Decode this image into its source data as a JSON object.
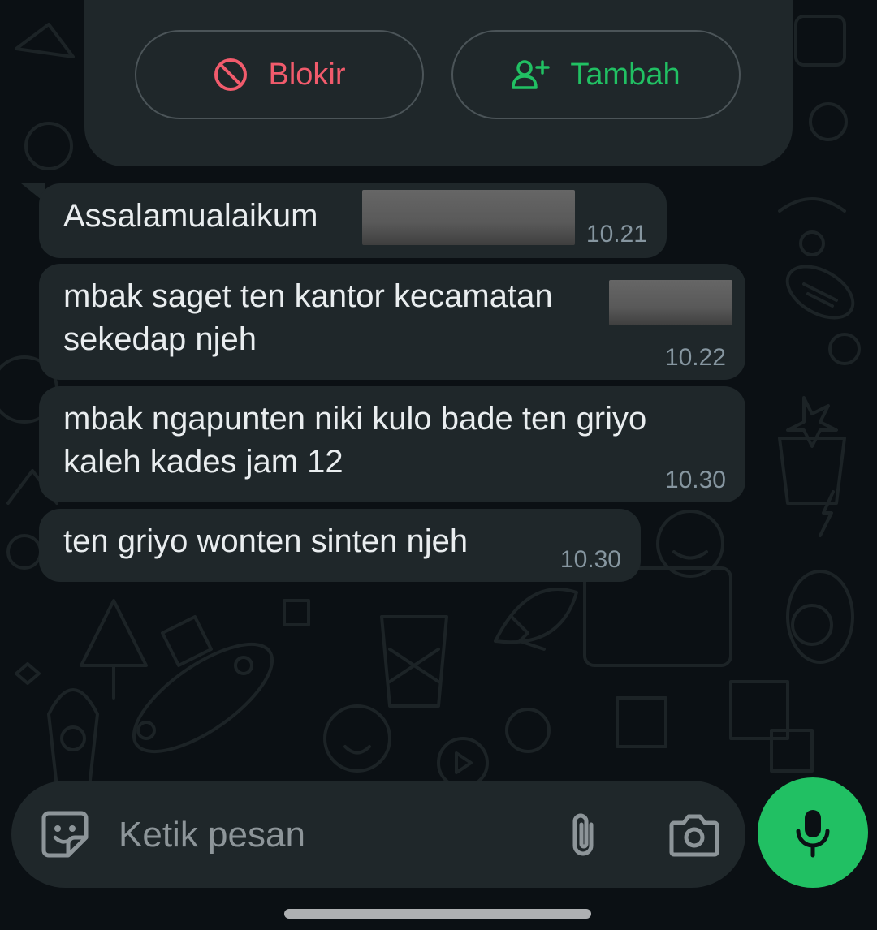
{
  "contact_actions": {
    "block_label": "Blokir",
    "add_label": "Tambah",
    "block_color": "#f15b6c",
    "add_color": "#21c063"
  },
  "messages": [
    {
      "text": "Assalamualaikum",
      "time": "10.21"
    },
    {
      "text": "mbak saget ten kantor kecamatan",
      "text_line2": "sekedap njeh",
      "time": "10.22"
    },
    {
      "text": "mbak ngapunten niki kulo bade ten griyo",
      "text_line2": "kaleh kades jam 12",
      "time": "10.30"
    },
    {
      "text": "ten griyo wonten sinten njeh",
      "time": "10.30"
    }
  ],
  "composer": {
    "placeholder": "Ketik pesan",
    "icons": [
      "sticker-icon",
      "attach-icon",
      "camera-icon",
      "mic-icon"
    ],
    "accent": "#21c063"
  },
  "theme": {
    "background": "#0b1014",
    "bubble": "#1f272a",
    "text": "#e9edef",
    "timestamp": "#8696a0"
  }
}
